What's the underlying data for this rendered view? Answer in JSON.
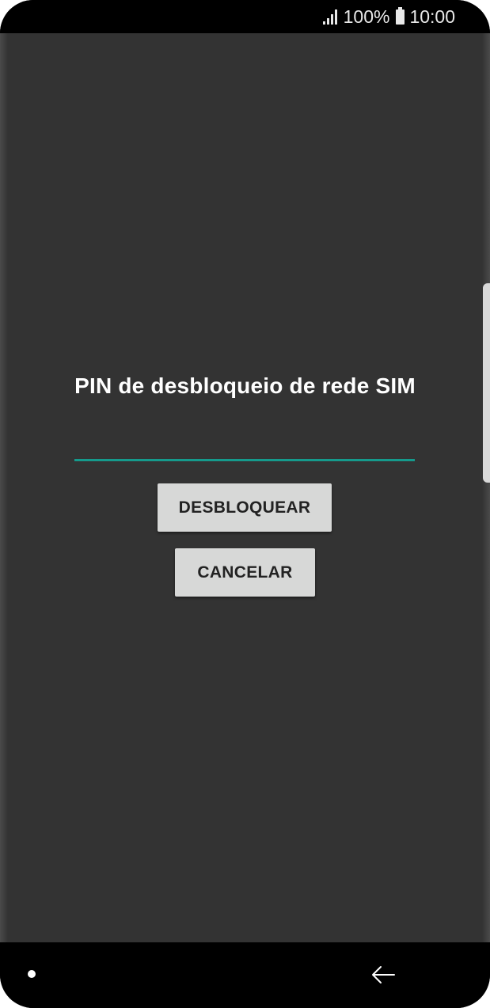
{
  "status_bar": {
    "battery_text": "100%",
    "time": "10:00",
    "signal_icon": "signal-icon",
    "battery_icon": "battery-icon"
  },
  "dialog": {
    "title": "PIN de desbloqueio de rede SIM",
    "pin_value": "",
    "unlock_label": "DESBLOQUEAR",
    "cancel_label": "CANCELAR"
  },
  "nav_bar": {
    "home_icon": "nav-dot-icon",
    "back_icon": "back-arrow-icon"
  },
  "colors": {
    "screen_background": "#333333",
    "accent_underline": "#159a8c",
    "button_background": "#d7d8d7"
  }
}
